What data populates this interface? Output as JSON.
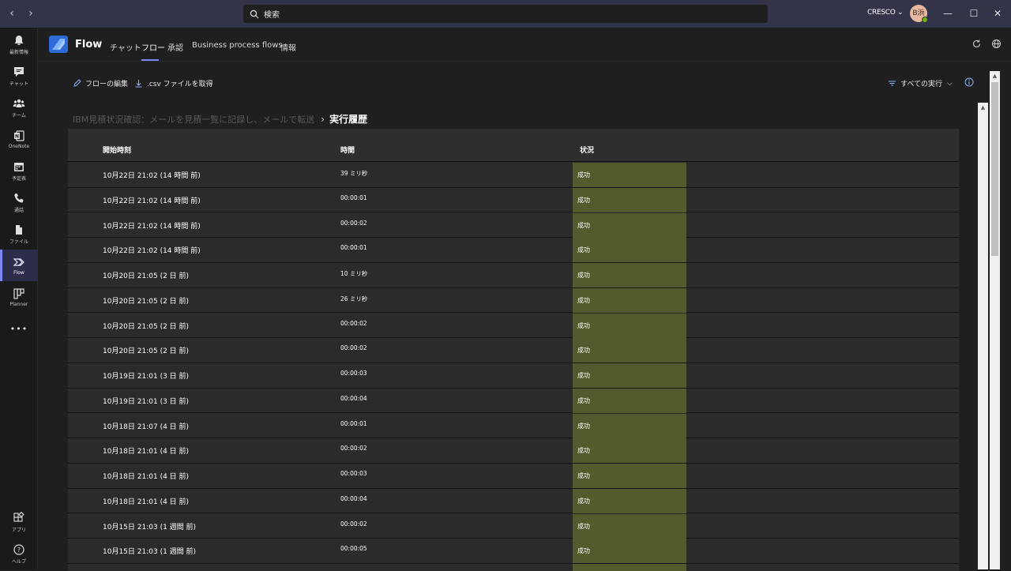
{
  "titlebar": {
    "search_placeholder": "検索",
    "org_label": "CRESCO ⌄",
    "avatar_initials": "B浜"
  },
  "rail": {
    "items": [
      {
        "label": "最新情報",
        "icon": "bell-icon"
      },
      {
        "label": "チャット",
        "icon": "chat-icon"
      },
      {
        "label": "チーム",
        "icon": "teams-icon"
      },
      {
        "label": "OneNote",
        "icon": "onenote-icon"
      },
      {
        "label": "予定表",
        "icon": "calendar-icon"
      },
      {
        "label": "通話",
        "icon": "phone-icon"
      },
      {
        "label": "ファイル",
        "icon": "file-icon"
      },
      {
        "label": "Flow",
        "icon": "flow-icon"
      },
      {
        "label": "Planner",
        "icon": "planner-icon"
      },
      {
        "label": "アプリ",
        "icon": "apps-icon"
      },
      {
        "label": "ヘルプ",
        "icon": "help-icon"
      }
    ],
    "more": "•••"
  },
  "apphead": {
    "name": "Flow",
    "tabs": [
      "チャット",
      "フロー",
      "承認",
      "Business process flows",
      "情報"
    ],
    "active_tab": "フロー"
  },
  "commands": {
    "edit": "フローの編集",
    "csv": ".csv ファイルを取得",
    "filter": "すべての実行"
  },
  "breadcrumb": {
    "flow_name": "IBM見積状況確認：メールを見積一覧に記録し、メールで転送",
    "current": "実行履歴"
  },
  "table": {
    "headers": {
      "start": "開始時刻",
      "duration": "時間",
      "status": "状況"
    },
    "rows": [
      {
        "start": "10月22日 21:02 (14 時間 前)",
        "duration": "39 ミリ秒",
        "status": "成功"
      },
      {
        "start": "10月22日 21:02 (14 時間 前)",
        "duration": "00:00:01",
        "status": "成功"
      },
      {
        "start": "10月22日 21:02 (14 時間 前)",
        "duration": "00:00:02",
        "status": "成功"
      },
      {
        "start": "10月22日 21:02 (14 時間 前)",
        "duration": "00:00:01",
        "status": "成功"
      },
      {
        "start": "10月20日 21:05 (2 日 前)",
        "duration": "10 ミリ秒",
        "status": "成功"
      },
      {
        "start": "10月20日 21:05 (2 日 前)",
        "duration": "26 ミリ秒",
        "status": "成功"
      },
      {
        "start": "10月20日 21:05 (2 日 前)",
        "duration": "00:00:02",
        "status": "成功"
      },
      {
        "start": "10月20日 21:05 (2 日 前)",
        "duration": "00:00:02",
        "status": "成功"
      },
      {
        "start": "10月19日 21:01 (3 日 前)",
        "duration": "00:00:03",
        "status": "成功"
      },
      {
        "start": "10月19日 21:01 (3 日 前)",
        "duration": "00:00:04",
        "status": "成功"
      },
      {
        "start": "10月18日 21:07 (4 日 前)",
        "duration": "00:00:01",
        "status": "成功"
      },
      {
        "start": "10月18日 21:01 (4 日 前)",
        "duration": "00:00:02",
        "status": "成功"
      },
      {
        "start": "10月18日 21:01 (4 日 前)",
        "duration": "00:00:03",
        "status": "成功"
      },
      {
        "start": "10月18日 21:01 (4 日 前)",
        "duration": "00:00:04",
        "status": "成功"
      },
      {
        "start": "10月15日 21:03 (1 週間 前)",
        "duration": "00:00:02",
        "status": "成功"
      },
      {
        "start": "10月15日 21:03 (1 週間 前)",
        "duration": "00:00:05",
        "status": "成功"
      },
      {
        "start": "",
        "duration": "",
        "status": ""
      }
    ]
  },
  "colors": {
    "titlebar": "#33344a",
    "accent": "#7f85f5",
    "success_cell": "#545a2c"
  }
}
